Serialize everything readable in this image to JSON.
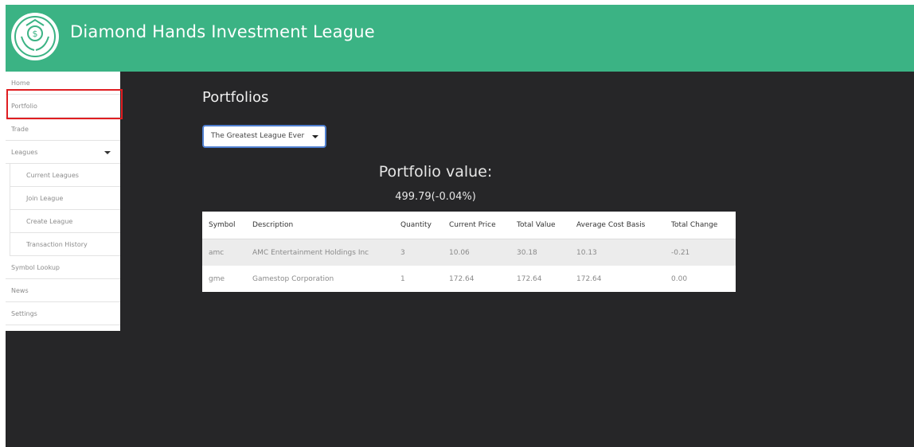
{
  "header": {
    "title": "Diamond Hands Investment League",
    "logo": "diamond-hands-logo-icon",
    "background_color": "#3bb384"
  },
  "sidebar": {
    "items": [
      {
        "label": "Home"
      },
      {
        "label": "Portfolio"
      },
      {
        "label": "Trade"
      },
      {
        "label": "Leagues"
      },
      {
        "label": "Current Leagues"
      },
      {
        "label": "Join League"
      },
      {
        "label": "Create League"
      },
      {
        "label": "Transaction History"
      },
      {
        "label": "Symbol Lookup"
      },
      {
        "label": "News"
      },
      {
        "label": "Settings"
      }
    ],
    "highlighted_item": "Portfolio",
    "highlight_color": "#e01e22"
  },
  "main": {
    "title": "Portfolios",
    "league_select": {
      "selected": "The Greatest League Ever"
    },
    "portfolio_value_label": "Portfolio value:",
    "portfolio_value": "499.79(-0.04%)",
    "table": {
      "columns": [
        "Symbol",
        "Description",
        "Quantity",
        "Current Price",
        "Total Value",
        "Average Cost Basis",
        "Total Change"
      ],
      "rows": [
        [
          "amc",
          "AMC Entertainment Holdings Inc",
          "3",
          "10.06",
          "30.18",
          "10.13",
          "-0.21"
        ],
        [
          "gme",
          "Gamestop Corporation",
          "1",
          "172.64",
          "172.64",
          "172.64",
          "0.00"
        ]
      ]
    }
  },
  "colors": {
    "page_background": "#262628",
    "dropdown_border": "#4f7fd0"
  }
}
